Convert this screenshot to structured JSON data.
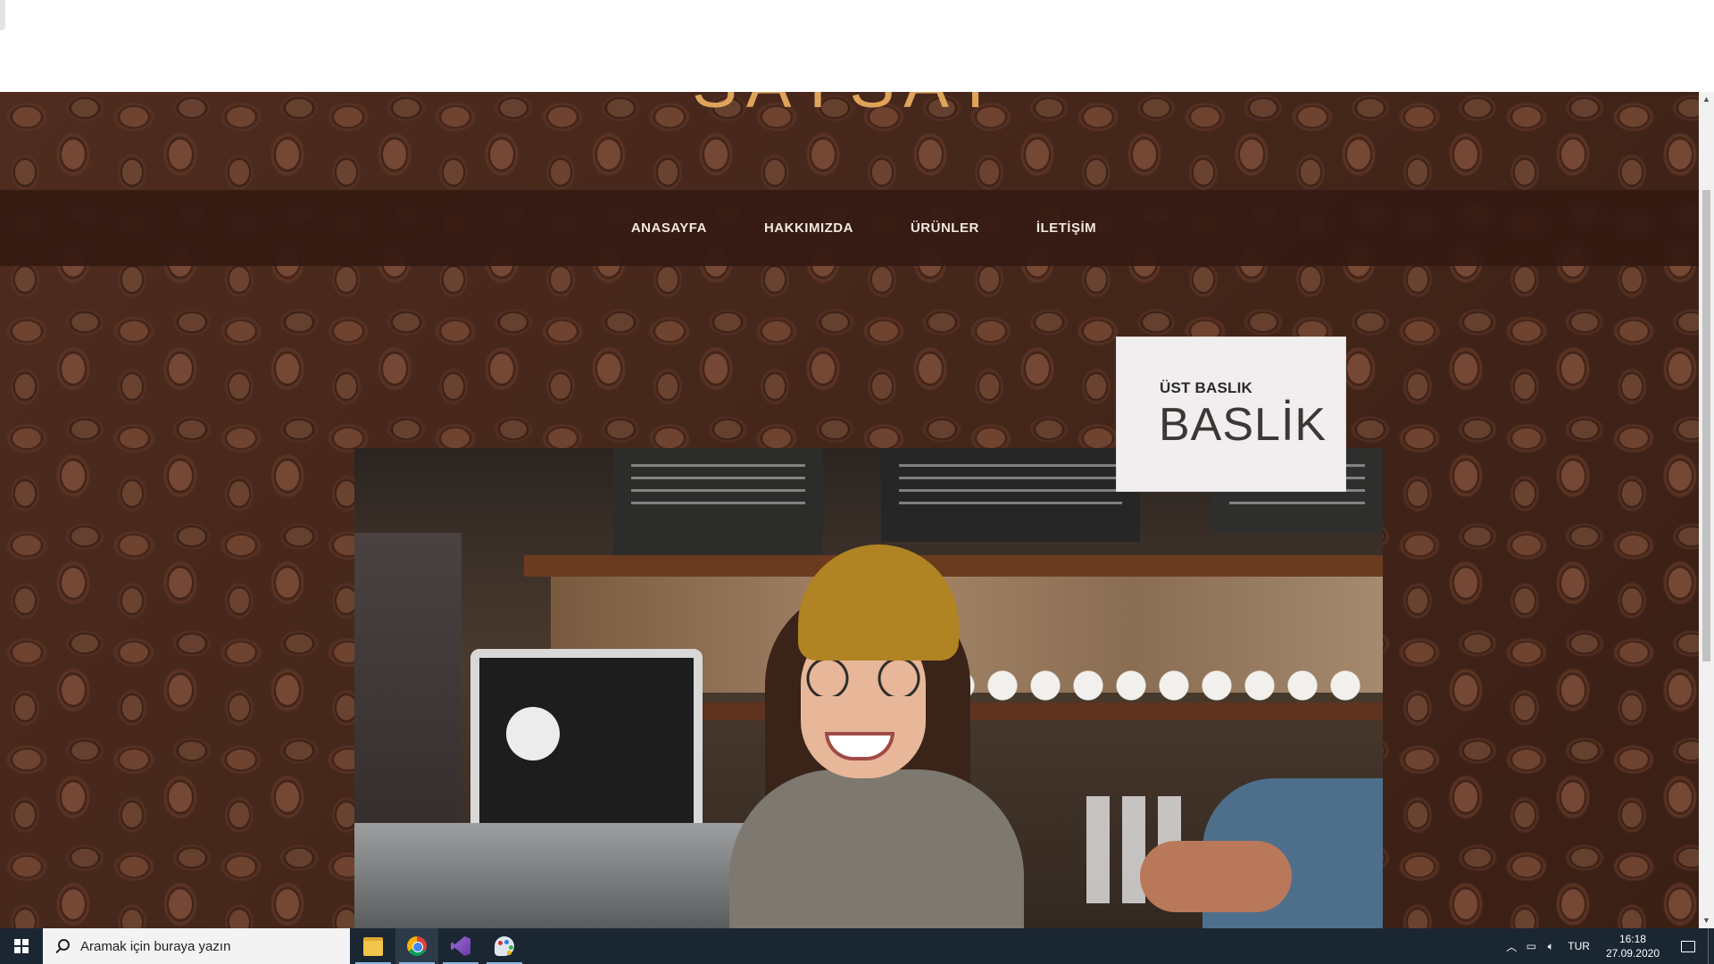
{
  "site": {
    "brand": "SAYSAY",
    "nav": [
      "ANASAYFA",
      "HAKKIMIZDA",
      "ÜRÜNLER",
      "İLETİŞİM"
    ],
    "card": {
      "subtitle": "ÜST BASLIK",
      "title": "BASLİK"
    }
  },
  "colors": {
    "brand": "#e0a35a",
    "navbar": "#341a12",
    "card": "#f0eeee",
    "taskbar": "#1b2633"
  },
  "taskbar": {
    "search_placeholder": "Aramak için buraya yazın",
    "apps": [
      {
        "name": "File Explorer",
        "icon": "folder-icon"
      },
      {
        "name": "Google Chrome",
        "icon": "chrome-icon"
      },
      {
        "name": "Visual Studio",
        "icon": "visual-studio-icon"
      },
      {
        "name": "Paint",
        "icon": "paint-icon"
      }
    ],
    "language": "TUR",
    "time": "16:18",
    "date": "27.09.2020"
  }
}
